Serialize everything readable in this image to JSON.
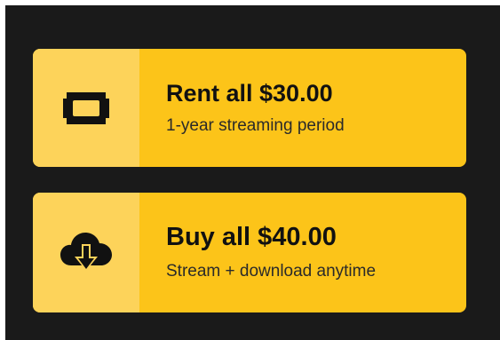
{
  "options": [
    {
      "id": "rent",
      "title": "Rent all $30.00",
      "subtitle": "1-year streaming period",
      "icon": "ticket-icon"
    },
    {
      "id": "buy",
      "title": "Buy all $40.00",
      "subtitle": "Stream + download anytime",
      "icon": "cloud-download-icon"
    }
  ],
  "colors": {
    "background": "#1a1a1a",
    "card": "#fcc419",
    "icon_area": "#fdd35a",
    "text": "#111111"
  }
}
